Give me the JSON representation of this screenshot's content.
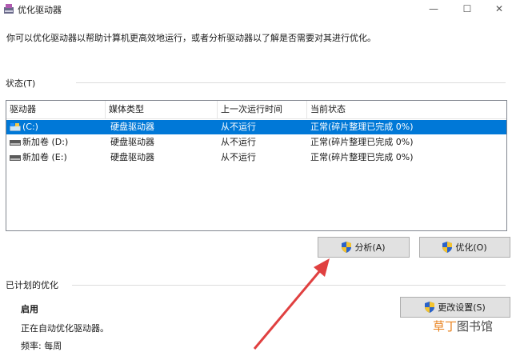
{
  "window": {
    "title": "优化驱动器",
    "controls": {
      "minimize": "—",
      "maximize": "☐",
      "close": "✕"
    },
    "app_icon": "disk-optimizer-icon"
  },
  "description": "你可以优化驱动器以帮助计算机更高效地运行，或者分析驱动器以了解是否需要对其进行优化。",
  "status_section": {
    "label": "状态(T)",
    "columns": [
      "驱动器",
      "媒体类型",
      "上一次运行时间",
      "当前状态"
    ],
    "rows": [
      {
        "drive": "(C:)",
        "media": "硬盘驱动器",
        "last_run": "从不运行",
        "status": "正常(碎片整理已完成 0%)",
        "selected": true,
        "icon": "system-drive-icon"
      },
      {
        "drive": "新加卷 (D:)",
        "media": "硬盘驱动器",
        "last_run": "从不运行",
        "status": "正常(碎片整理已完成 0%)",
        "selected": false,
        "icon": "hard-drive-icon"
      },
      {
        "drive": "新加卷 (E:)",
        "media": "硬盘驱动器",
        "last_run": "从不运行",
        "status": "正常(碎片整理已完成 0%)",
        "selected": false,
        "icon": "hard-drive-icon"
      }
    ]
  },
  "buttons": {
    "analyze": "分析(A)",
    "optimize": "优化(O)",
    "change_settings": "更改设置(S)"
  },
  "scheduled_section": {
    "label": "已计划的优化",
    "state": "启用",
    "detail": "正在自动优化驱动器。",
    "frequency": "频率: 每周"
  },
  "watermark": {
    "part1": "草丁",
    "part2": "图书馆"
  },
  "colors": {
    "selection": "#0078d7",
    "arrow": "#e04040",
    "shield_blue": "#2a62c9",
    "shield_yellow": "#f4c430"
  }
}
